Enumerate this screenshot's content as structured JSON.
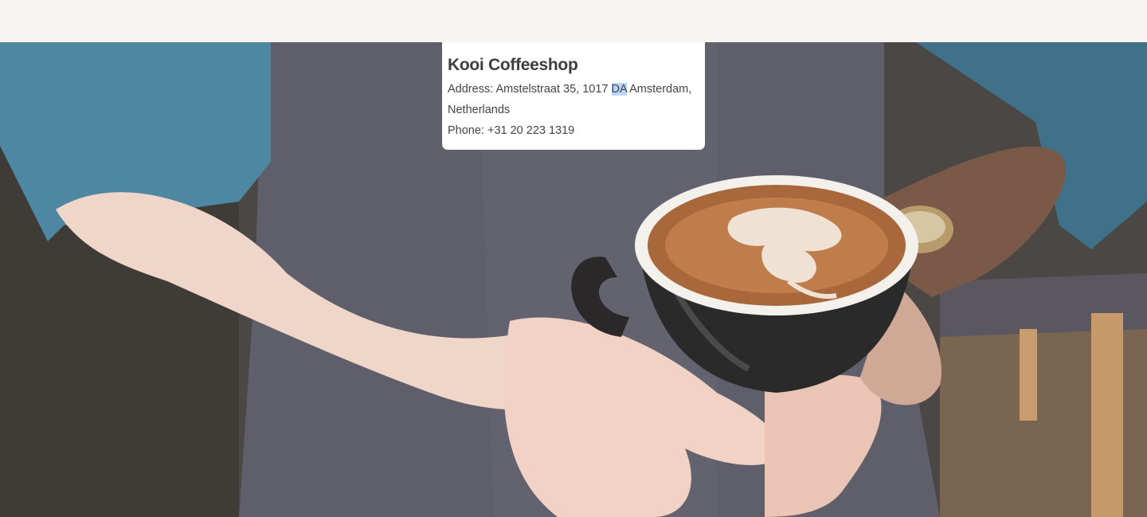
{
  "header": {},
  "hero": {
    "image_alt": "Person in denim shirt and apron holding a latte cup"
  },
  "shop": {
    "name": "Kooi Coffeeshop",
    "address_before": "Address: Amstelstraat 35, 1017 ",
    "address_highlight": "DA",
    "address_after": " Amsterdam, Netherlands",
    "phone": "Phone: +31 20 223 1319"
  },
  "colors": {
    "page_bg": "#f8f4f1",
    "card_bg": "#ffffff",
    "text": "#444444",
    "selection": "#b8d7fb"
  }
}
